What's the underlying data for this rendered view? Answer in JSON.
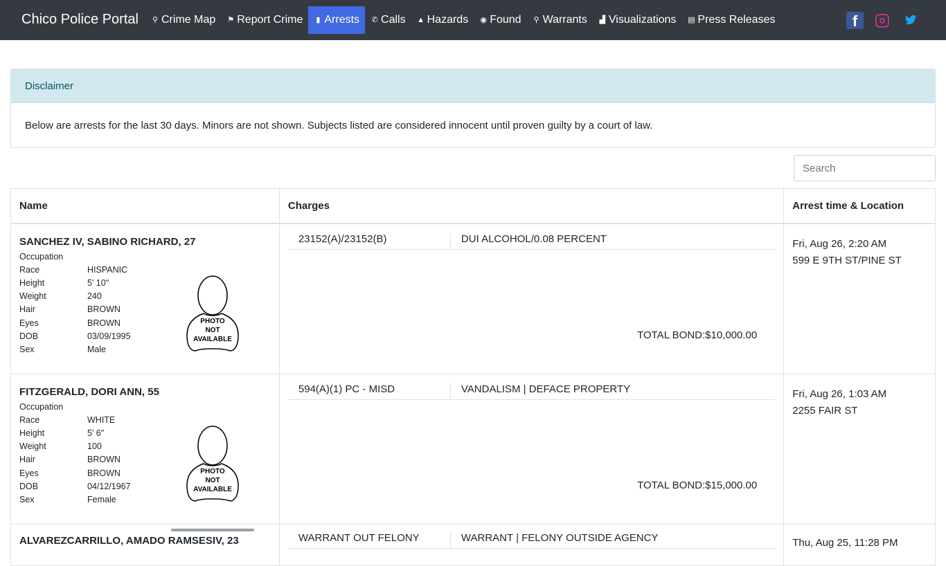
{
  "nav": {
    "brand": "Chico Police Portal",
    "items": [
      {
        "label": "Crime Map",
        "icon": "map-marker-icon"
      },
      {
        "label": "Report Crime",
        "icon": "flag-icon"
      },
      {
        "label": "Arrests",
        "icon": "id-card-icon"
      },
      {
        "label": "Calls",
        "icon": "phone-icon"
      },
      {
        "label": "Hazards",
        "icon": "warning-icon"
      },
      {
        "label": "Found",
        "icon": "compass-icon"
      },
      {
        "label": "Warrants",
        "icon": "magnify-icon"
      },
      {
        "label": "Visualizations",
        "icon": "chart-icon"
      },
      {
        "label": "Press Releases",
        "icon": "newspaper-icon"
      }
    ],
    "active": "Arrests",
    "accent": "#4169e1"
  },
  "disclaimer": {
    "title": "Disclaimer",
    "body": "Below are arrests for the last 30 days. Minors are not shown. Subjects listed are considered innocent until proven guilty by a court of law."
  },
  "search": {
    "placeholder": "Search"
  },
  "table": {
    "headers": {
      "name": "Name",
      "charges": "Charges",
      "arrest": "Arrest time & Location"
    },
    "attr_labels": {
      "occupation": "Occupation",
      "race": "Race",
      "height": "Height",
      "weight": "Weight",
      "hair": "Hair",
      "eyes": "Eyes",
      "dob": "DOB",
      "sex": "Sex"
    },
    "photo_text": [
      "PHOTO",
      "NOT",
      "AVAILABLE"
    ],
    "rows": [
      {
        "name": "SANCHEZ IV, SABINO RICHARD, 27",
        "race": "HISPANIC",
        "height": "5' 10\"",
        "weight": "240",
        "hair": "BROWN",
        "eyes": "BROWN",
        "dob": "03/09/1995",
        "sex": "Male",
        "charge_code": "23152(A)/23152(B)",
        "charge_desc": "DUI ALCOHOL/0.08 PERCENT",
        "bond": "TOTAL BOND:$10,000.00",
        "arrest_time": "Fri, Aug 26, 2:20 AM",
        "arrest_location": "599 E 9TH ST/PINE ST"
      },
      {
        "name": "FITZGERALD, DORI ANN, 55",
        "race": "WHITE",
        "height": "5' 6\"",
        "weight": "100",
        "hair": "BROWN",
        "eyes": "BROWN",
        "dob": "04/12/1967",
        "sex": "Female",
        "charge_code": "594(A)(1) PC - MISD",
        "charge_desc": "VANDALISM | DEFACE PROPERTY",
        "bond": "TOTAL BOND:$15,000.00",
        "arrest_time": "Fri, Aug 26, 1:03 AM",
        "arrest_location": "2255 FAIR ST"
      },
      {
        "name": "ALVAREZCARRILLO, AMADO RAMSESIV, 23",
        "charge_code": "WARRANT OUT FELONY",
        "charge_desc": "WARRANT | FELONY OUTSIDE AGENCY",
        "arrest_time": "Thu, Aug 25, 11:28 PM"
      }
    ]
  }
}
